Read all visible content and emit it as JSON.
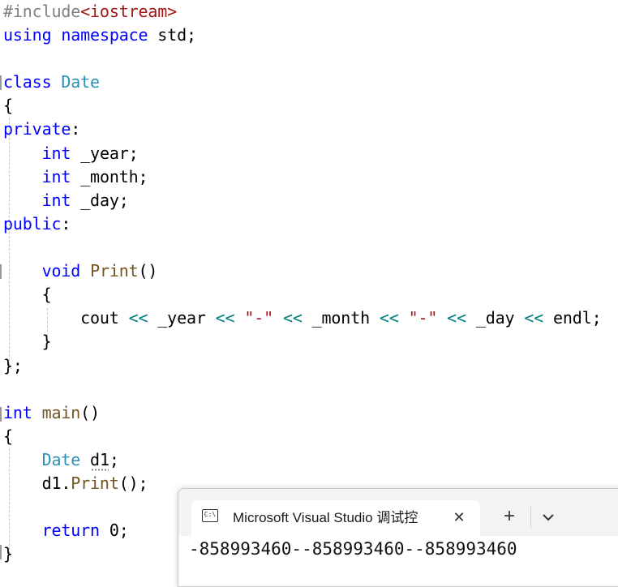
{
  "editor": {
    "colors": {
      "keyword": "#0000ff",
      "type": "#2b91af",
      "string": "#a31515",
      "operator": "#008080",
      "function": "#74531f",
      "macro": "#808080",
      "plain": "#000000"
    },
    "lines": [
      [
        {
          "t": "#include",
          "c": "macro"
        },
        {
          "t": "<iostream>",
          "c": "string"
        }
      ],
      [
        {
          "t": "using",
          "c": "keyword"
        },
        {
          "t": " ",
          "c": "plain"
        },
        {
          "t": "namespace",
          "c": "keyword"
        },
        {
          "t": " std;",
          "c": "plain"
        }
      ],
      [],
      [
        {
          "t": "class",
          "c": "keyword"
        },
        {
          "t": " ",
          "c": "plain"
        },
        {
          "t": "Date",
          "c": "type"
        }
      ],
      [
        {
          "t": "{",
          "c": "plain"
        }
      ],
      [
        {
          "t": "private",
          "c": "keyword"
        },
        {
          "t": ":",
          "c": "plain"
        }
      ],
      [
        {
          "t": "    ",
          "c": "plain"
        },
        {
          "t": "int",
          "c": "keyword"
        },
        {
          "t": " _year;",
          "c": "plain"
        }
      ],
      [
        {
          "t": "    ",
          "c": "plain"
        },
        {
          "t": "int",
          "c": "keyword"
        },
        {
          "t": " _month;",
          "c": "plain"
        }
      ],
      [
        {
          "t": "    ",
          "c": "plain"
        },
        {
          "t": "int",
          "c": "keyword"
        },
        {
          "t": " _day;",
          "c": "plain"
        }
      ],
      [
        {
          "t": "public",
          "c": "keyword"
        },
        {
          "t": ":",
          "c": "plain"
        }
      ],
      [],
      [
        {
          "t": "    ",
          "c": "plain"
        },
        {
          "t": "void",
          "c": "keyword"
        },
        {
          "t": " ",
          "c": "plain"
        },
        {
          "t": "Print",
          "c": "function"
        },
        {
          "t": "()",
          "c": "plain"
        }
      ],
      [
        {
          "t": "    {",
          "c": "plain"
        }
      ],
      [
        {
          "t": "        cout ",
          "c": "plain"
        },
        {
          "t": "<<",
          "c": "operator"
        },
        {
          "t": " _year ",
          "c": "plain"
        },
        {
          "t": "<<",
          "c": "operator"
        },
        {
          "t": " ",
          "c": "plain"
        },
        {
          "t": "\"-\"",
          "c": "string"
        },
        {
          "t": " ",
          "c": "plain"
        },
        {
          "t": "<<",
          "c": "operator"
        },
        {
          "t": " _month ",
          "c": "plain"
        },
        {
          "t": "<<",
          "c": "operator"
        },
        {
          "t": " ",
          "c": "plain"
        },
        {
          "t": "\"-\"",
          "c": "string"
        },
        {
          "t": " ",
          "c": "plain"
        },
        {
          "t": "<<",
          "c": "operator"
        },
        {
          "t": " _day ",
          "c": "plain"
        },
        {
          "t": "<<",
          "c": "operator"
        },
        {
          "t": " endl;",
          "c": "plain"
        }
      ],
      [
        {
          "t": "    }",
          "c": "plain"
        }
      ],
      [
        {
          "t": "};",
          "c": "plain"
        }
      ],
      [],
      [
        {
          "t": "int",
          "c": "keyword"
        },
        {
          "t": " ",
          "c": "plain"
        },
        {
          "t": "main",
          "c": "function"
        },
        {
          "t": "()",
          "c": "plain"
        }
      ],
      [
        {
          "t": "{",
          "c": "plain"
        }
      ],
      [
        {
          "t": "    ",
          "c": "plain"
        },
        {
          "t": "Date",
          "c": "type"
        },
        {
          "t": " d1;",
          "c": "plain"
        }
      ],
      [
        {
          "t": "    d1.",
          "c": "plain"
        },
        {
          "t": "Print",
          "c": "function"
        },
        {
          "t": "();",
          "c": "plain"
        }
      ],
      [],
      [
        {
          "t": "    ",
          "c": "plain"
        },
        {
          "t": "return",
          "c": "keyword"
        },
        {
          "t": " 0;",
          "c": "plain"
        }
      ],
      [
        {
          "t": "}",
          "c": "plain"
        }
      ]
    ]
  },
  "terminal": {
    "tab_icon": "console-icon",
    "tab_icon_glyph": "C:\\",
    "tab_title": "Microsoft Visual Studio 调试控",
    "close_glyph": "✕",
    "new_tab_glyph": "+",
    "output": "-858993460--858993460--858993460"
  }
}
